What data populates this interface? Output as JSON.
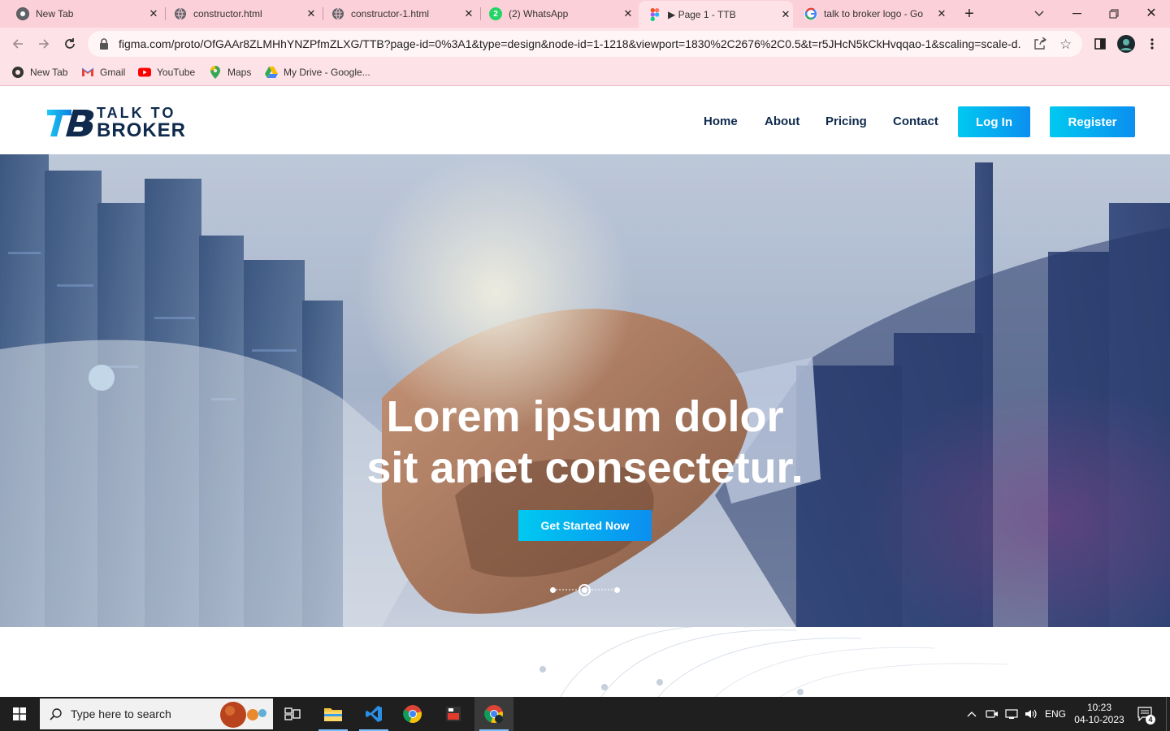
{
  "browser": {
    "tabs": [
      {
        "label": "New Tab",
        "icon": "chrome-icon"
      },
      {
        "label": "constructor.html",
        "icon": "globe-icon"
      },
      {
        "label": "constructor-1.html",
        "icon": "globe-icon"
      },
      {
        "label": "(2) WhatsApp",
        "icon": "whatsapp-icon",
        "badge": "2"
      },
      {
        "label": "▶ Page 1 - TTB",
        "icon": "figma-icon",
        "active": true
      },
      {
        "label": "talk to broker logo - Go",
        "icon": "google-icon"
      }
    ],
    "url": "figma.com/proto/OfGAAr8ZLMHhYNZPfmZLXG/TTB?page-id=0%3A1&type=design&node-id=1-1218&viewport=1830%2C2676%2C0.5&t=r5JHcN5kCkHvqqao-1&scaling=scale-d...",
    "bookmarks": [
      {
        "label": "New Tab",
        "icon": "chrome-icon"
      },
      {
        "label": "Gmail",
        "icon": "gmail-icon"
      },
      {
        "label": "YouTube",
        "icon": "youtube-icon"
      },
      {
        "label": "Maps",
        "icon": "maps-icon"
      },
      {
        "label": "My Drive - Google...",
        "icon": "drive-icon"
      }
    ]
  },
  "site": {
    "logo_top": "TALK TO",
    "logo_bottom": "BROKER",
    "logo_mark": "TB",
    "nav": [
      "Home",
      "About",
      "Pricing",
      "Contact"
    ],
    "login_label": "Log In",
    "register_label": "Register",
    "hero_line1": "Lorem ipsum dolor",
    "hero_line2": "sit amet consectetur.",
    "hero_cta": "Get Started Now",
    "slider_dots": 3,
    "slider_active_index": 1
  },
  "taskbar": {
    "search_placeholder": "Type here to search",
    "language": "ENG",
    "time": "10:23",
    "date": "04-10-2023",
    "notification_count": "4"
  },
  "colors": {
    "accent": "#0fb6f0",
    "navy": "#0f2a4d",
    "tabstrip": "#fcd0d8"
  }
}
